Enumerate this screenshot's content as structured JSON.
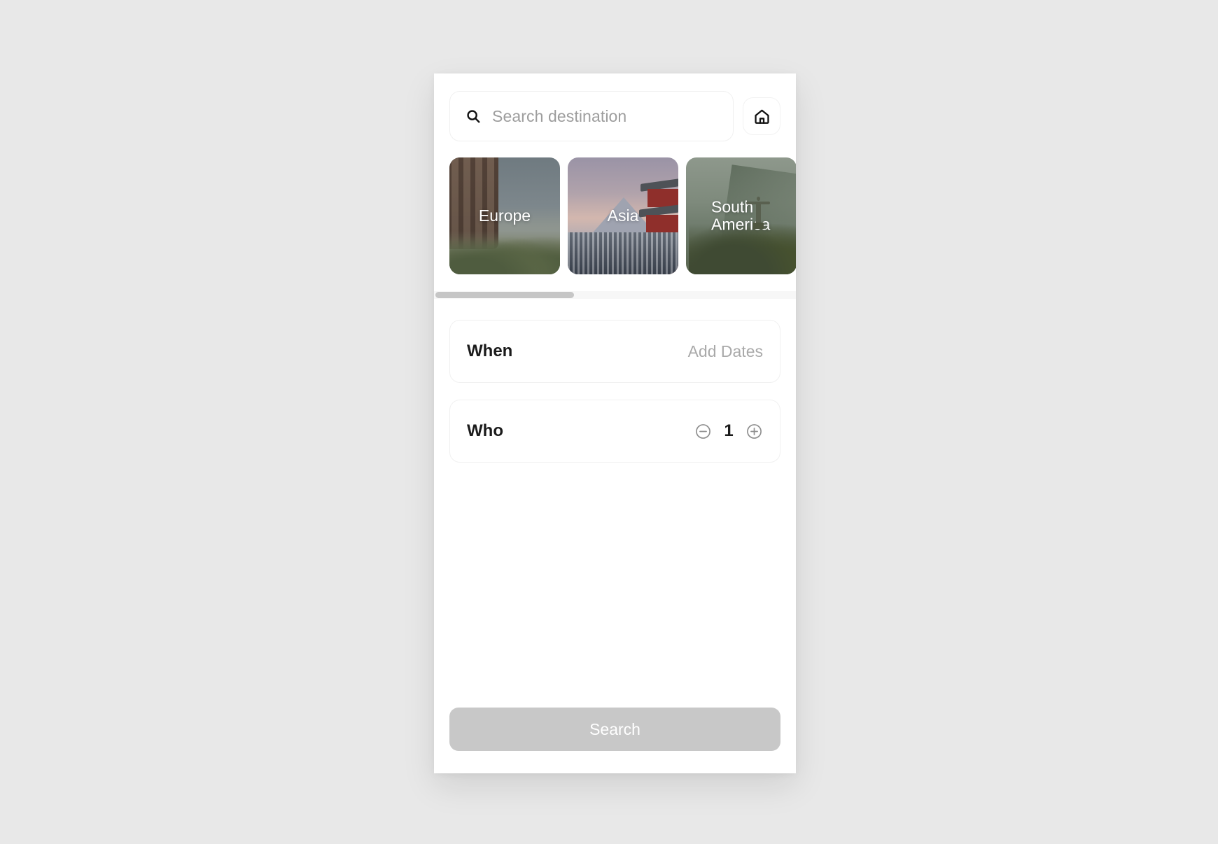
{
  "search": {
    "placeholder": "Search destination",
    "icon": "search-icon",
    "home_icon": "home-icon"
  },
  "destinations": [
    {
      "label": "Europe",
      "art": "colosseum"
    },
    {
      "label": "Asia",
      "art": "mount-fuji-pagoda"
    },
    {
      "label": "South\nAmerica",
      "art": "christ-the-redeemer"
    }
  ],
  "options": {
    "when": {
      "title": "When",
      "value": "Add Dates"
    },
    "who": {
      "title": "Who",
      "count": "1",
      "decrement_icon": "minus-circle-icon",
      "increment_icon": "plus-circle-icon"
    }
  },
  "footer": {
    "search_label": "Search"
  },
  "colors": {
    "page_background": "#e8e8e8",
    "panel_background": "#ffffff",
    "border": "#f0f0f0",
    "placeholder_text": "#9d9d9d",
    "title_text": "#1b1b1b",
    "muted_text": "#a9a9a9",
    "scrollbar_track": "#f7f7f7",
    "scrollbar_thumb": "#c6c6c6",
    "search_button": "#c8c8c8",
    "search_button_text": "#ffffff"
  }
}
